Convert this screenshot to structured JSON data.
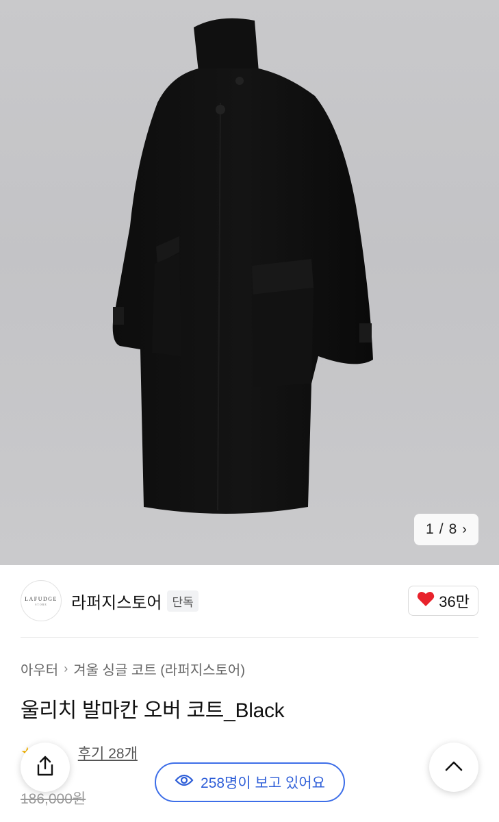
{
  "gallery": {
    "current": "1",
    "separator": "/",
    "total": "8"
  },
  "store": {
    "logo_text": "LAFUDGE",
    "logo_sub": "STORE",
    "name": "라퍼지스토어",
    "badge": "단독",
    "likes": "36만"
  },
  "breadcrumb": {
    "category": "아우터",
    "subcategory": "겨울 싱글 코트 (라퍼지스토어)"
  },
  "product": {
    "title": "울리치 발마칸 오버 코트_Black",
    "review_label": "후기 28개",
    "original_price": "186,000원"
  },
  "viewers": {
    "label": "258명이 보고 있어요"
  },
  "colors": {
    "accent": "#3d6ee8",
    "heart": "#e8222b",
    "star": "#f5b400"
  }
}
